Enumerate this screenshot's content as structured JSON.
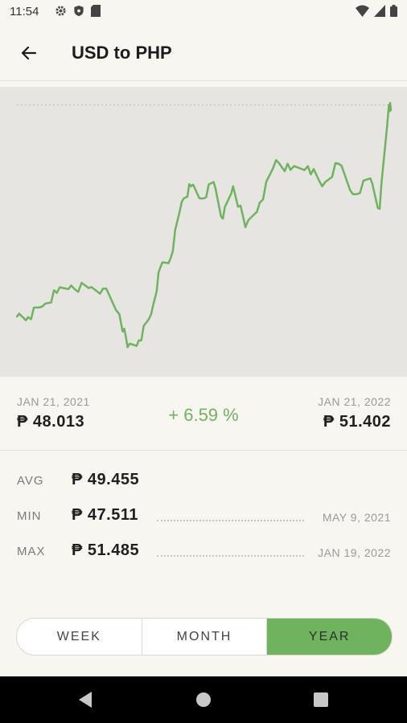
{
  "status_bar": {
    "time": "11:54"
  },
  "header": {
    "title": "USD to PHP"
  },
  "summary": {
    "start_date": "JAN 21, 2021",
    "start_value": "₱ 48.013",
    "change": "+ 6.59 %",
    "end_date": "JAN 21, 2022",
    "end_value": "₱ 51.402"
  },
  "stats": {
    "avg": {
      "label": "AVG",
      "value": "₱ 49.455"
    },
    "min": {
      "label": "MIN",
      "value": "₱ 47.511",
      "date": "MAY 9, 2021"
    },
    "max": {
      "label": "MAX",
      "value": "₱ 51.485",
      "date": "JAN 19, 2022"
    }
  },
  "ranges": {
    "week": "WEEK",
    "month": "MONTH",
    "year": "YEAR",
    "active": "YEAR"
  },
  "colors": {
    "accent": "#6fb35f",
    "chart_bg": "#e6e5e2"
  },
  "chart_data": {
    "type": "line",
    "x": [
      "2021-01-21",
      "2021-02-01",
      "2021-02-15",
      "2021-03-01",
      "2021-03-15",
      "2021-04-01",
      "2021-04-15",
      "2021-05-01",
      "2021-05-09",
      "2021-05-20",
      "2021-06-01",
      "2021-06-10",
      "2021-06-20",
      "2021-07-01",
      "2021-07-10",
      "2021-07-20",
      "2021-08-01",
      "2021-08-10",
      "2021-08-20",
      "2021-09-01",
      "2021-09-15",
      "2021-10-01",
      "2021-10-15",
      "2021-11-01",
      "2021-11-15",
      "2021-12-01",
      "2021-12-15",
      "2022-01-01",
      "2022-01-10",
      "2022-01-19",
      "2022-01-21"
    ],
    "series": [
      {
        "values": [
          48.01,
          48.0,
          48.18,
          48.4,
          48.52,
          48.48,
          48.47,
          48.05,
          47.51,
          47.62,
          48.05,
          48.82,
          48.97,
          49.9,
          50.15,
          49.95,
          50.22,
          49.62,
          50.15,
          49.48,
          49.88,
          50.58,
          50.42,
          50.48,
          50.15,
          50.52,
          50.02,
          50.28,
          49.78,
          51.485,
          51.4
        ]
      }
    ],
    "reference_line": 51.485,
    "ylim": [
      47.3,
      51.6
    ],
    "grid": false
  }
}
